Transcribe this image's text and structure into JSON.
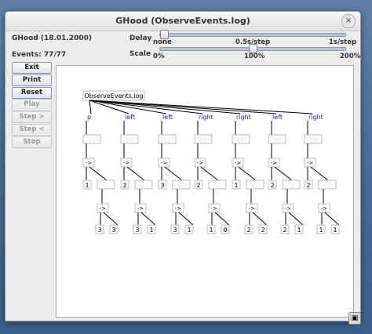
{
  "window": {
    "title": "GHood (ObserveEvents.log)",
    "close_glyph": "×"
  },
  "info": {
    "version": "GHood (18.01.2000)",
    "events": "Events: 77/77"
  },
  "delay": {
    "label": "Delay",
    "ticks": [
      "none",
      "0.5s/step",
      "1s/step"
    ],
    "value_fraction": 0.02
  },
  "scale": {
    "label": "Scale",
    "ticks": [
      "0%",
      "100%",
      "200%"
    ],
    "value_fraction": 0.5
  },
  "buttons": [
    {
      "label": "Exit",
      "enabled": true
    },
    {
      "label": "Print",
      "enabled": true
    },
    {
      "label": "Reset",
      "enabled": true
    },
    {
      "label": "Play",
      "enabled": false
    },
    {
      "label": "Step >",
      "enabled": false
    },
    {
      "label": "Step <",
      "enabled": false
    },
    {
      "label": "Stop",
      "enabled": false
    }
  ],
  "graph": {
    "root": "ObserveEvents.log",
    "columns": [
      {
        "event": "p",
        "left": "1",
        "bottom": [
          "3",
          "3"
        ]
      },
      {
        "event": "left",
        "left": "2",
        "bottom": [
          "3",
          "1"
        ]
      },
      {
        "event": "left",
        "left": "3",
        "bottom": [
          "3",
          "1"
        ]
      },
      {
        "event": "right",
        "left": "2",
        "bottom": [
          "1",
          "0"
        ]
      },
      {
        "event": "right",
        "left": "1",
        "bottom": [
          "2",
          "2"
        ]
      },
      {
        "event": "left",
        "left": "2",
        "bottom": [
          "2",
          "1"
        ]
      },
      {
        "event": "right",
        "left": "2",
        "bottom": [
          "1",
          "1"
        ]
      }
    ],
    "con_label": "(:)",
    "arrow_label": "->",
    "cons_label": "(:)",
    "colors": {
      "event_text": "#1a1adc",
      "faded_box": "#dcdcdc",
      "line": "#000000"
    }
  },
  "taskbar_icon": "▣"
}
